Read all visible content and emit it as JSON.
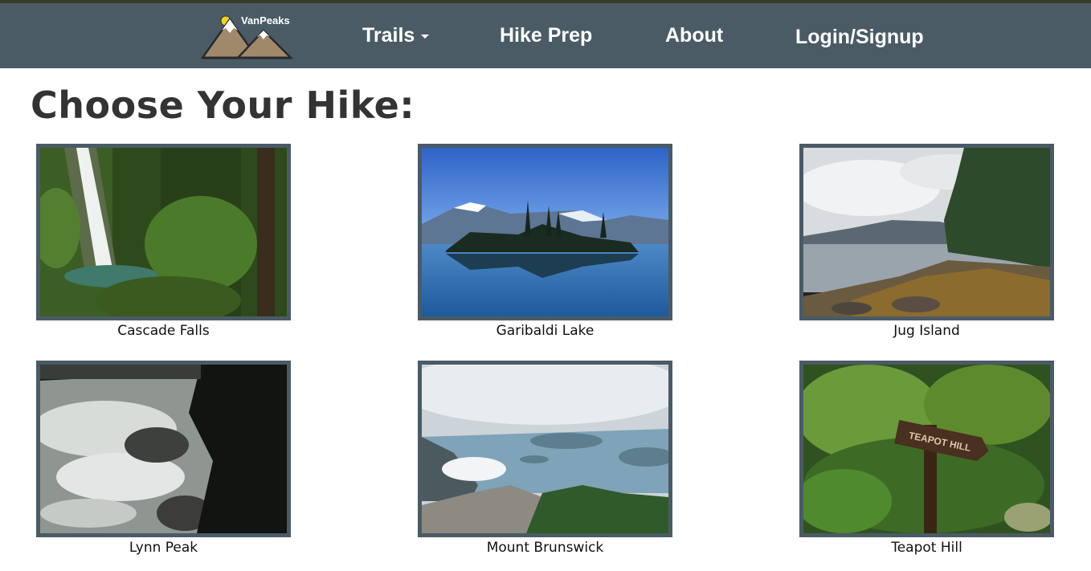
{
  "brand": {
    "name": "VanPeaks"
  },
  "nav": {
    "trails": "Trails",
    "hike_prep": "Hike Prep",
    "about": "About",
    "login": "Login/Signup"
  },
  "page": {
    "title": "Choose Your Hike:"
  },
  "hikes": [
    {
      "name": "Cascade Falls"
    },
    {
      "name": "Garibaldi Lake"
    },
    {
      "name": "Jug Island"
    },
    {
      "name": "Lynn Peak"
    },
    {
      "name": "Mount Brunswick"
    },
    {
      "name": "Teapot Hill"
    }
  ],
  "signs": {
    "teapot": "TEAPOT HILL"
  }
}
